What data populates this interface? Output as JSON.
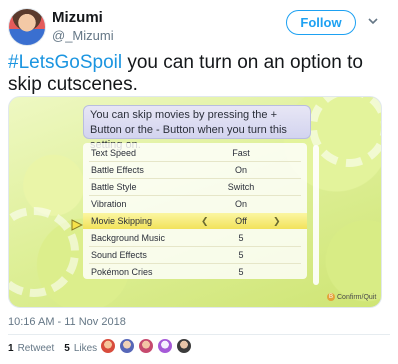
{
  "author": {
    "name": "Mizumi",
    "handle": "@_Mizumi"
  },
  "follow_label": "Follow",
  "tweet": {
    "hashtag": "#LetsGoSpoil",
    "text": " you can turn on an option to skip cutscenes."
  },
  "game_screen": {
    "message": "You can skip movies by pressing the + Button or the - Button when you turn this setting on.",
    "settings": [
      {
        "label": "Text Speed",
        "value": "Fast"
      },
      {
        "label": "Battle Effects",
        "value": "On"
      },
      {
        "label": "Battle Style",
        "value": "Switch"
      },
      {
        "label": "Vibration",
        "value": "On"
      },
      {
        "label": "Movie Skipping",
        "value": "Off"
      },
      {
        "label": "Background Music",
        "value": "5"
      },
      {
        "label": "Sound Effects",
        "value": "5"
      },
      {
        "label": "Pokémon Cries",
        "value": "5"
      }
    ],
    "selected_index": 4,
    "confirm_label": "Confirm/Quit"
  },
  "timestamp": "10:16 AM - 11 Nov 2018",
  "stats": {
    "retweets": "1",
    "retweets_label": "Retweet",
    "likes": "5",
    "likes_label": "Likes"
  },
  "colors": {
    "accent": "#1da1f2",
    "hashtag": "#1b95e0"
  }
}
